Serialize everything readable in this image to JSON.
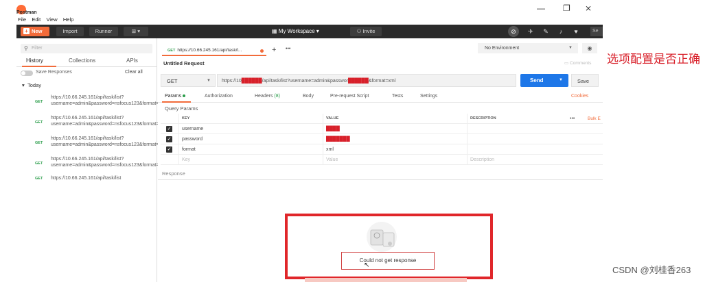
{
  "window": {
    "app_name": "Postman",
    "minimize": "—",
    "maximize": "❐",
    "close": "⨯"
  },
  "menu": [
    "File",
    "Edit",
    "View",
    "Help"
  ],
  "toolbar": {
    "new_label": "New",
    "import_label": "Import",
    "runner_label": "Runner",
    "workspace_label": "My Workspace",
    "invite_label": "Invite",
    "search_short": "Se"
  },
  "sidebar": {
    "filter_placeholder": "Filter",
    "tabs": [
      "History",
      "Collections",
      "APIs"
    ],
    "save_responses": "Save Responses",
    "clear_all": "Clear all",
    "group_label": "Today",
    "history": [
      {
        "method": "GET",
        "url": "https://10.66.245.161/api/task/list?username=admin&password=nsfocus123&format=xml"
      },
      {
        "method": "GET",
        "url": "https://10.66.245.161/api/task/list?username=admin&password=nsfocus123&format=xml"
      },
      {
        "method": "GET",
        "url": "https://10.66.245.161/api/task/list?username=admin&password=nsfocus123&format=xml"
      },
      {
        "method": "GET",
        "url": "https://10.66.245.161/api/task/list?username=admin&password=nsfocus123&format=xml"
      },
      {
        "method": "GET",
        "url": "https://10.66.245.161/api/task/list"
      }
    ]
  },
  "request": {
    "tab_method": "GET",
    "tab_url": "https://10.66.245.161/api/task/l...",
    "environment": "No Environment",
    "name": "Untitled Request",
    "comments": "Comments",
    "method": "GET",
    "url_prefix": "https://10",
    "url_redacted_1": "██████",
    "url_mid": "/api/task/list?username=admin&passwor",
    "url_redacted_2": "██████",
    "url_suffix": "&format=xml",
    "send_label": "Send",
    "save_label": "Save",
    "subtabs": [
      {
        "label": "Params",
        "extra": ""
      },
      {
        "label": "Authorization",
        "extra": ""
      },
      {
        "label": "Headers",
        "extra": "(8)"
      },
      {
        "label": "Body",
        "extra": ""
      },
      {
        "label": "Pre-request Script",
        "extra": ""
      },
      {
        "label": "Tests",
        "extra": ""
      },
      {
        "label": "Settings",
        "extra": ""
      }
    ],
    "cookies": "Cookies",
    "query_params_label": "Query Params",
    "table": {
      "headers": [
        "KEY",
        "VALUE",
        "DESCRIPTION"
      ],
      "more": "•••",
      "bulk_edit": "Bulk E",
      "rows": [
        {
          "checked": true,
          "key": "username",
          "value": "████",
          "description": ""
        },
        {
          "checked": true,
          "key": "password",
          "value": "███████",
          "description": ""
        },
        {
          "checked": true,
          "key": "format",
          "value": "xml",
          "description": ""
        }
      ],
      "placeholder": {
        "key": "Key",
        "value": "Value",
        "description": "Description"
      }
    },
    "response_label": "Response",
    "no_response": "Could not get response"
  },
  "annotation": "选项配置是否正确",
  "watermark": "CSDN @刘桂香263"
}
